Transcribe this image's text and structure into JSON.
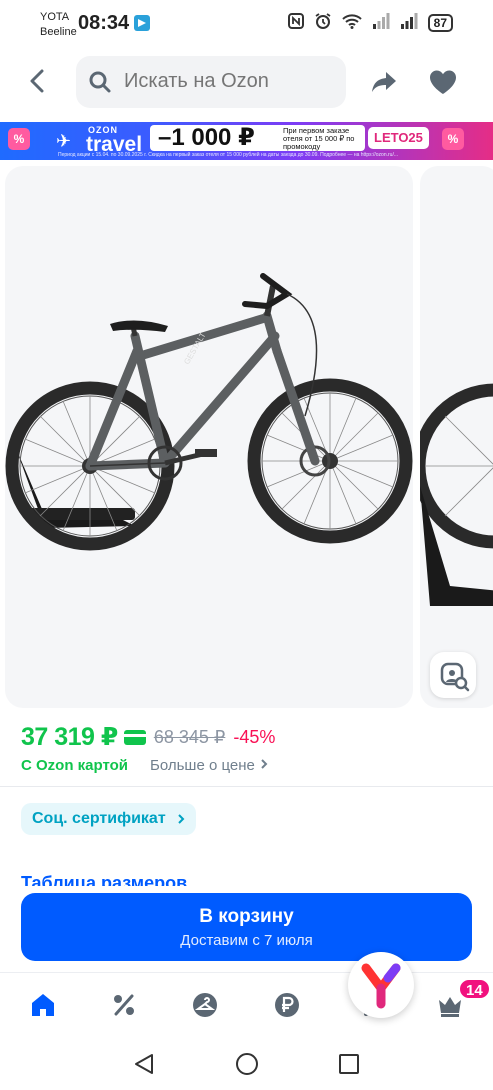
{
  "status_bar": {
    "carrier_1": "YOTA",
    "carrier_2": "Beeline",
    "time": "08:34",
    "battery": "87",
    "icons": [
      "nfc-icon",
      "alarm-icon",
      "wifi-icon",
      "signal-icon",
      "signal-icon"
    ]
  },
  "header": {
    "search_placeholder": "Искать на Ozon",
    "icons": [
      "back-arrow-icon",
      "search-icon",
      "share-icon",
      "heart-icon"
    ]
  },
  "banner": {
    "percent_badge": "%",
    "brand_top": "OZON",
    "brand_bottom": "travel",
    "amount": "–1 000 ₽",
    "text": "При первом заказе отеля от 15 000 ₽ по промокоду",
    "promo_code": "LETO25",
    "fine_print": "Период акции с 15.04. по 30.09.2025 г. Скидка на первый заказ отеля от 15 000 рублей на даты заезда до 30.09. Подробнее — на https://ozon.ru/..."
  },
  "gallery": {
    "icons": [
      "visual-search-icon"
    ]
  },
  "price": {
    "with_card": "37 319 ₽",
    "old": "68 345 ₽",
    "discount": "-45%",
    "card_label": "С Ozon картой",
    "more_label": "Больше о цене",
    "accent_color": "#10c44c",
    "discount_color": "#f91155"
  },
  "certificate_chip": "Соц. сертификат",
  "size_table_link": "Таблица размеров",
  "cart_button": {
    "title": "В корзину",
    "subtitle": "Доставим с 7 июля",
    "color": "#005bff"
  },
  "bottom_nav": {
    "items": [
      "home-icon",
      "percent-icon",
      "hanger-icon",
      "ruble-icon",
      "cart-icon",
      "crown-icon"
    ],
    "badge": "14"
  },
  "system_nav": {
    "icons": [
      "back-triangle-icon",
      "home-circle-icon",
      "recents-square-icon"
    ]
  }
}
